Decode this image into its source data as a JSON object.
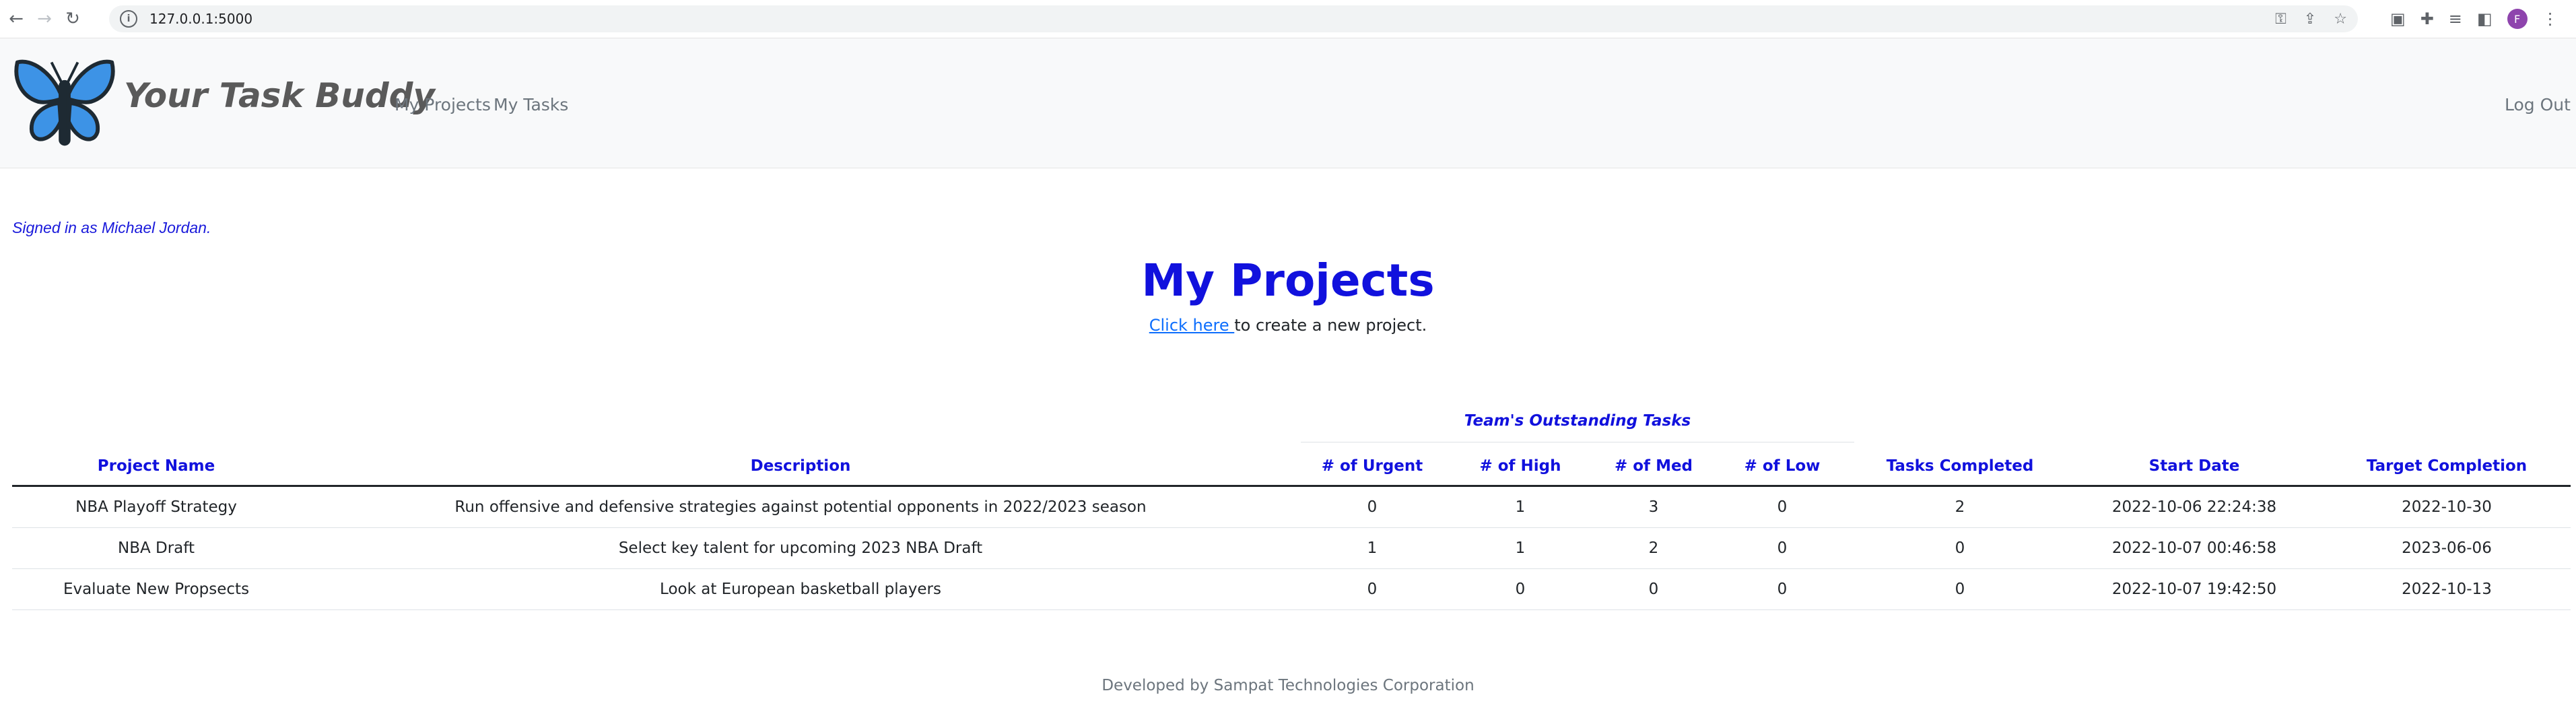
{
  "browser": {
    "url": "127.0.0.1:5000",
    "profile_initial": "F"
  },
  "navbar": {
    "brand": "Your Task Buddy",
    "links": [
      "My Projects",
      "My Tasks"
    ],
    "logout": "Log Out",
    "logo_colors": {
      "wing": "#3d93e6",
      "outline": "#1e2a33"
    }
  },
  "content": {
    "signed_in": "Signed in as Michael Jordan.",
    "title": "My Projects",
    "create_link": "Click here ",
    "create_rest": "to create a new project.",
    "group_header": "Team's Outstanding Tasks"
  },
  "table": {
    "headers": [
      "Project Name",
      "Description",
      "# of Urgent",
      "# of High",
      "# of Med",
      "# of Low",
      "Tasks Completed",
      "Start Date",
      "Target Completion"
    ],
    "rows": [
      [
        "NBA Playoff Strategy",
        "Run offensive and defensive strategies against potential opponents in 2022/2023 season",
        "0",
        "1",
        "3",
        "0",
        "2",
        "2022-10-06 22:24:38",
        "2022-10-30"
      ],
      [
        "NBA Draft",
        "Select key talent for upcoming 2023 NBA Draft",
        "1",
        "1",
        "2",
        "0",
        "0",
        "2022-10-07 00:46:58",
        "2023-06-06"
      ],
      [
        "Evaluate New Propsects",
        "Look at European basketball players",
        "0",
        "0",
        "0",
        "0",
        "0",
        "2022-10-07 19:42:50",
        "2022-10-13"
      ]
    ]
  },
  "footer": "Developed by Sampat Technologies Corporation"
}
